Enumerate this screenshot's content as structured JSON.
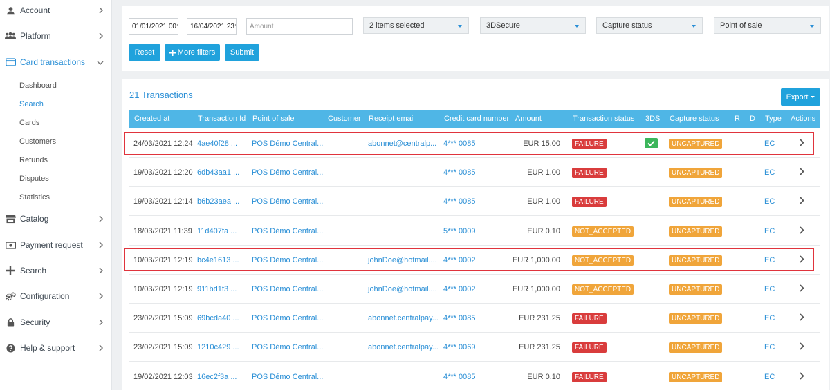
{
  "sidebar": {
    "items": [
      {
        "label": "Account",
        "icon": "user-icon"
      },
      {
        "label": "Platform",
        "icon": "users-icon"
      },
      {
        "label": "Card transactions",
        "icon": "credit-card-icon"
      },
      {
        "label": "Catalog",
        "icon": "store-icon"
      },
      {
        "label": "Payment request",
        "icon": "money-icon"
      },
      {
        "label": "Search",
        "icon": "plus-icon"
      },
      {
        "label": "Configuration",
        "icon": "cogs-icon"
      },
      {
        "label": "Security",
        "icon": "lock-icon"
      },
      {
        "label": "Help & support",
        "icon": "question-circle-icon"
      }
    ],
    "card_transactions_sub": [
      "Dashboard",
      "Search",
      "Cards",
      "Customers",
      "Refunds",
      "Disputes",
      "Statistics"
    ],
    "active_sub": "Search"
  },
  "filters": {
    "date_from": "01/01/2021 00:",
    "date_to": "16/04/2021 23:",
    "amount_placeholder": "Amount",
    "selects": [
      "2 items selected",
      "3DSecure",
      "Capture status",
      "Point of sale"
    ],
    "reset_label": "Reset",
    "more_filters_label": "More filters",
    "submit_label": "Submit"
  },
  "results": {
    "title": "21 Transactions",
    "export_label": "Export",
    "columns": [
      "Created at",
      "Transaction Id",
      "Point of sale",
      "Customer",
      "Receipt email",
      "Credit card number",
      "Amount",
      "Transaction status",
      "3DS",
      "Capture status",
      "R",
      "D",
      "Type",
      "Actions"
    ],
    "rows": [
      {
        "created": "24/03/2021 12:24",
        "txid": "4ae40f28 ...",
        "pos": "POS Démo Central...",
        "customer": "",
        "email": "abonnet@centralp...",
        "card": "4*** 0085",
        "amount": "EUR 15.00",
        "status": "FAILURE",
        "threeds": true,
        "capture": "UNCAPTURED",
        "type": "EC"
      },
      {
        "created": "19/03/2021 12:20",
        "txid": "6db43aa1 ...",
        "pos": "POS Démo Central...",
        "customer": "",
        "email": "",
        "card": "4*** 0085",
        "amount": "EUR 1.00",
        "status": "FAILURE",
        "threeds": false,
        "capture": "UNCAPTURED",
        "type": "EC"
      },
      {
        "created": "19/03/2021 12:14",
        "txid": "b6b23aea ...",
        "pos": "POS Démo Central...",
        "customer": "",
        "email": "",
        "card": "4*** 0085",
        "amount": "EUR 1.00",
        "status": "FAILURE",
        "threeds": false,
        "capture": "UNCAPTURED",
        "type": "EC"
      },
      {
        "created": "18/03/2021 11:39",
        "txid": "11d407fa ...",
        "pos": "POS Démo Central...",
        "customer": "",
        "email": "",
        "card": "5*** 0009",
        "amount": "EUR 0.10",
        "status": "NOT_ACCEPTED",
        "threeds": false,
        "capture": "UNCAPTURED",
        "type": "EC"
      },
      {
        "created": "10/03/2021 12:19",
        "txid": "bc4e1613 ...",
        "pos": "POS Démo Central...",
        "customer": "",
        "email": "johnDoe@hotmail....",
        "card": "4*** 0002",
        "amount": "EUR 1,000.00",
        "status": "NOT_ACCEPTED",
        "threeds": false,
        "capture": "UNCAPTURED",
        "type": "EC"
      },
      {
        "created": "10/03/2021 12:19",
        "txid": "911bd1f3 ...",
        "pos": "POS Démo Central...",
        "customer": "",
        "email": "johnDoe@hotmail....",
        "card": "4*** 0002",
        "amount": "EUR 1,000.00",
        "status": "NOT_ACCEPTED",
        "threeds": false,
        "capture": "UNCAPTURED",
        "type": "EC"
      },
      {
        "created": "23/02/2021 15:09",
        "txid": "69bcda40 ...",
        "pos": "POS Démo Central...",
        "customer": "",
        "email": "abonnet.centralpay...",
        "card": "4*** 0085",
        "amount": "EUR 231.25",
        "status": "FAILURE",
        "threeds": false,
        "capture": "UNCAPTURED",
        "type": "EC"
      },
      {
        "created": "23/02/2021 15:09",
        "txid": "1210c429 ...",
        "pos": "POS Démo Central...",
        "customer": "",
        "email": "abonnet.centralpay...",
        "card": "4*** 0069",
        "amount": "EUR 231.25",
        "status": "FAILURE",
        "threeds": false,
        "capture": "UNCAPTURED",
        "type": "EC"
      },
      {
        "created": "19/02/2021 12:03",
        "txid": "16ec2f3a ...",
        "pos": "POS Démo Central...",
        "customer": "",
        "email": "",
        "card": "4*** 0085",
        "amount": "EUR 0.10",
        "status": "FAILURE",
        "threeds": false,
        "capture": "UNCAPTURED",
        "type": "EC"
      }
    ]
  },
  "colors": {
    "accent": "#2a8fd6",
    "header": "#4fb6e6",
    "button": "#20a2dc",
    "failure": "#d93c3c",
    "warning": "#f0a53a",
    "success": "#3cb65b",
    "highlight": "#e0343d"
  }
}
